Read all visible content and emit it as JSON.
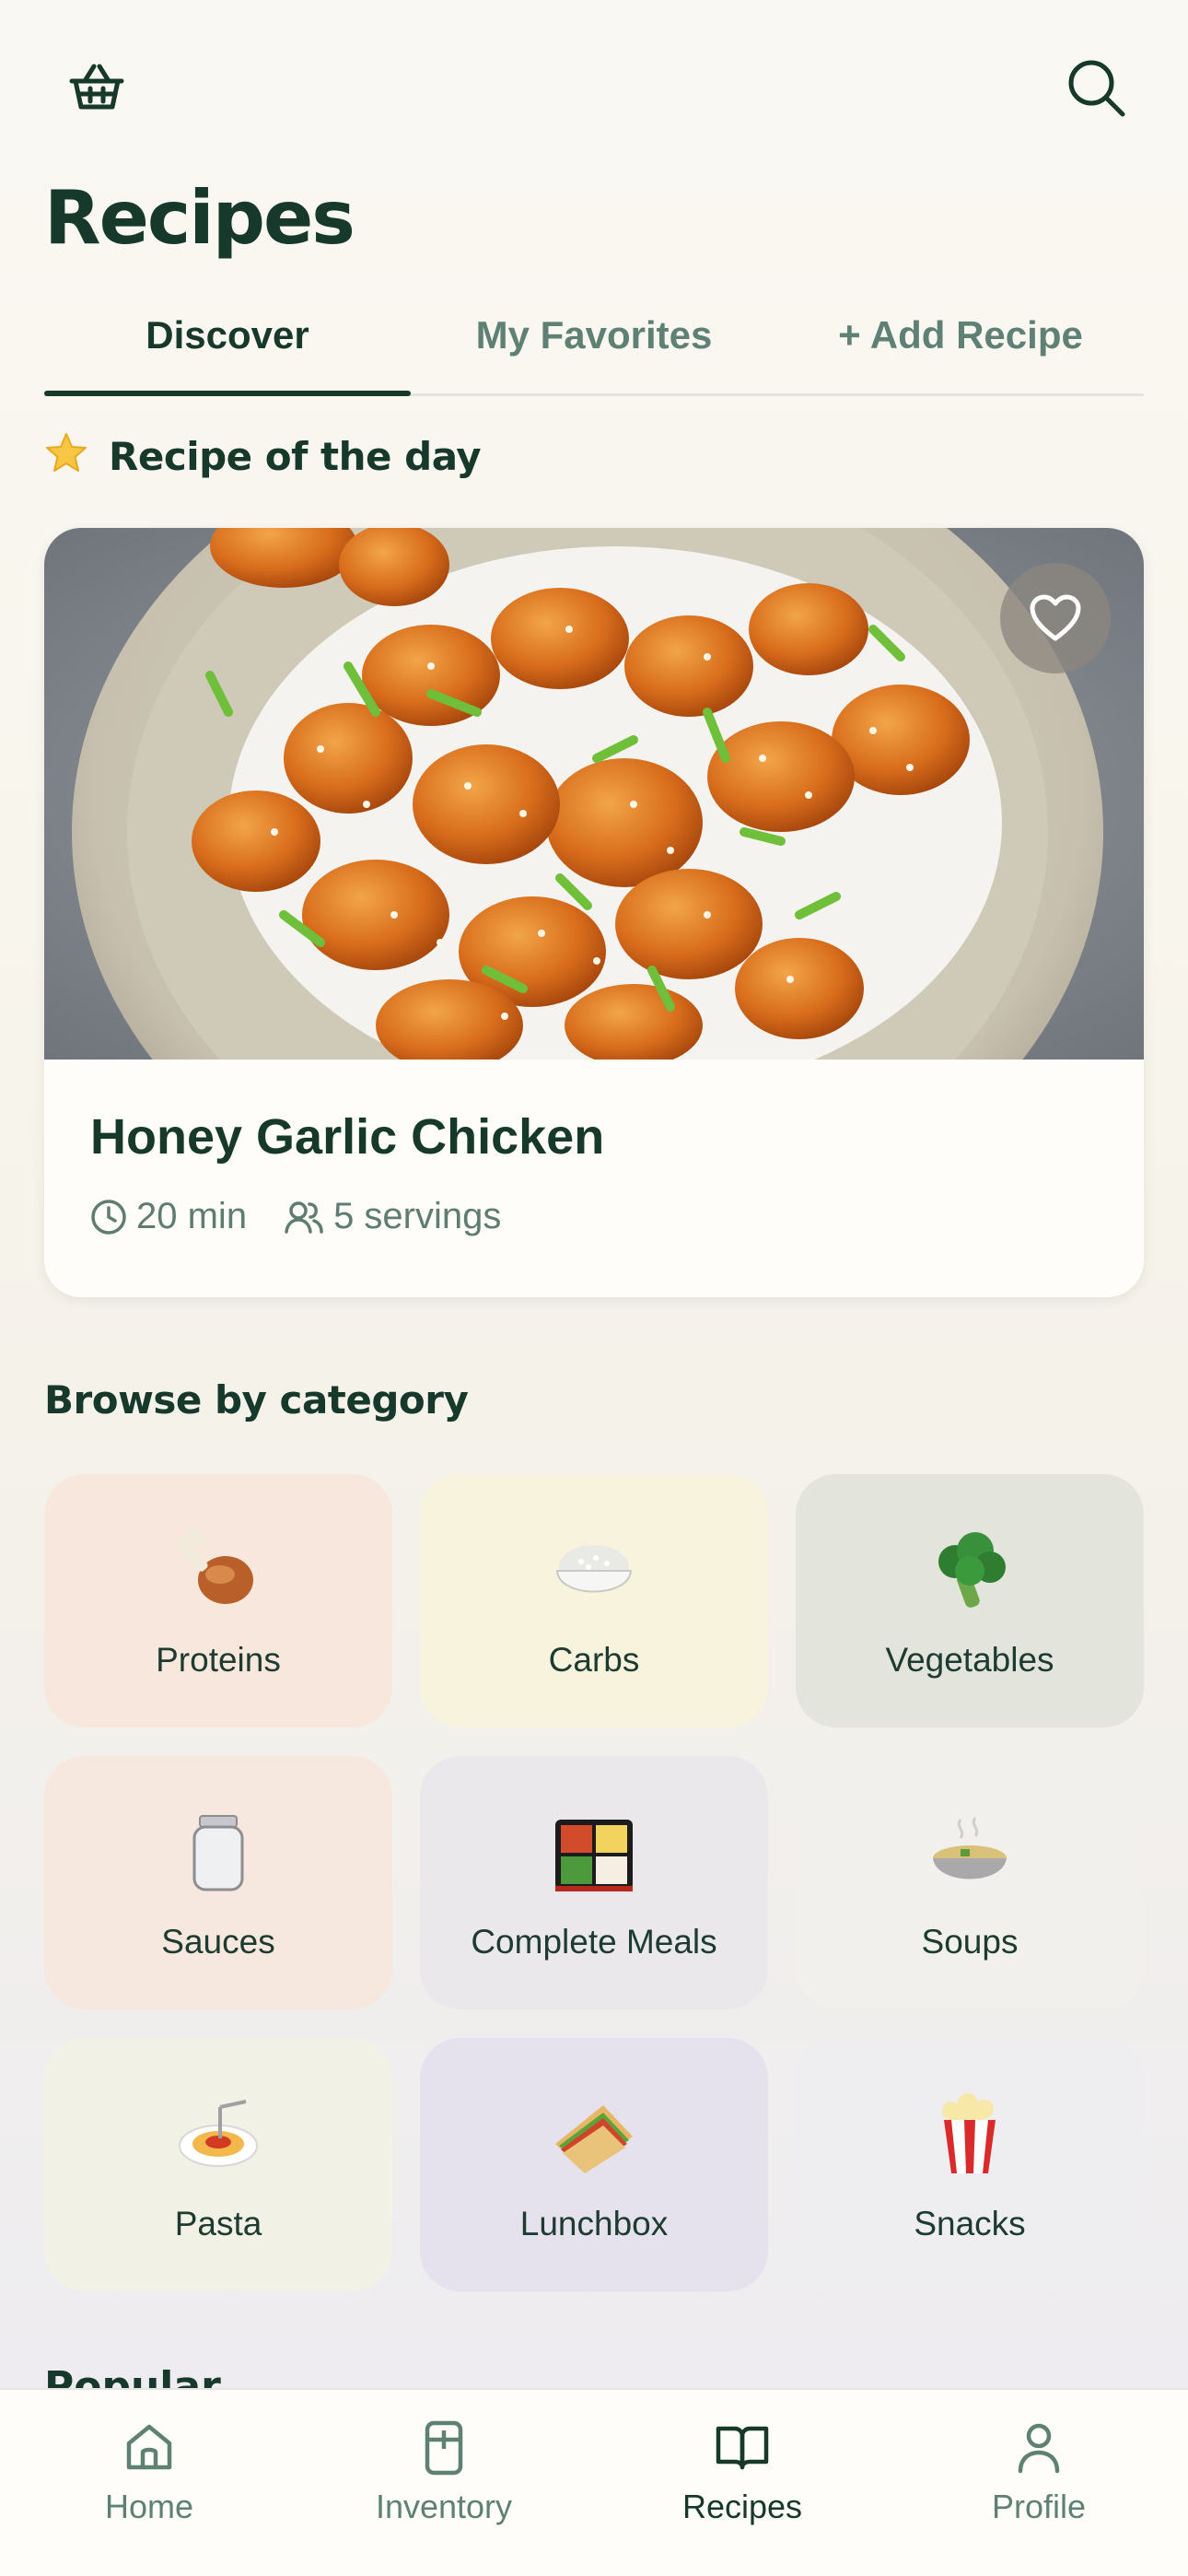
{
  "header": {
    "title": "Recipes",
    "basket_icon": "basket-icon",
    "search_icon": "search-icon"
  },
  "tabs": [
    {
      "label": "Discover",
      "active": true
    },
    {
      "label": "My Favorites",
      "active": false
    },
    {
      "label": "+ Add Recipe",
      "active": false
    }
  ],
  "recipe_of_day": {
    "heading": "Recipe of the day",
    "title": "Honey Garlic Chicken",
    "time": "20 min",
    "servings": "5 servings"
  },
  "categories": {
    "heading": "Browse by category",
    "items": [
      {
        "label": "Proteins",
        "emoji": "🍗",
        "bg": "#f8e7dc"
      },
      {
        "label": "Carbs",
        "emoji": "🍚",
        "bg": "#f8f3dc"
      },
      {
        "label": "Vegetables",
        "emoji": "🥦",
        "bg": "#e3e4dc"
      },
      {
        "label": "Sauces",
        "emoji": "🫙",
        "bg": "#f7e8df"
      },
      {
        "label": "Complete Meals",
        "emoji": "🍱",
        "bg": "#ebe8ec"
      },
      {
        "label": "Soups",
        "emoji": "🍲",
        "bg": "#f1f0ec"
      },
      {
        "label": "Pasta",
        "emoji": "🍝",
        "bg": "#f2f1e5"
      },
      {
        "label": "Lunchbox",
        "emoji": "🥪",
        "bg": "#e5e2ee"
      },
      {
        "label": "Snacks",
        "emoji": "🍿",
        "bg": "#eeedf0"
      }
    ]
  },
  "next_section_peek": "Popular",
  "bottom_nav": [
    {
      "label": "Home",
      "icon": "home-icon",
      "active": false
    },
    {
      "label": "Inventory",
      "icon": "fridge-icon",
      "active": false
    },
    {
      "label": "Recipes",
      "icon": "book-icon",
      "active": true
    },
    {
      "label": "Profile",
      "icon": "user-icon",
      "active": false
    }
  ],
  "colors": {
    "primary": "#17392c",
    "muted": "#5f8175",
    "card_bg": "#fefdf9"
  }
}
